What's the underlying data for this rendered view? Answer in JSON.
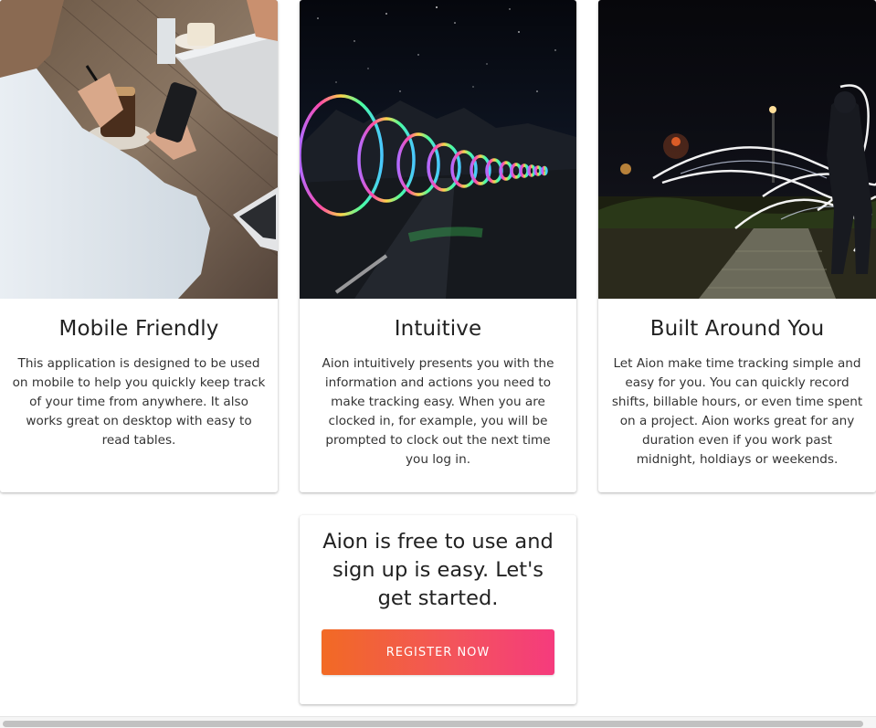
{
  "features": [
    {
      "image": "person-using-phone-at-cafe-photo",
      "title": "Mobile Friendly",
      "text": "This application is designed to be used on mobile to help you quickly keep track of your time from anywhere. It also works great on desktop with easy to read tables."
    },
    {
      "image": "light-painting-spiral-night-road-photo",
      "title": "Intuitive",
      "text": "Aion intuitively presents you with the information and actions you need to make tracking easy. When you are clocked in, for example, you will be prompted to clock out the next time you log in."
    },
    {
      "image": "person-light-painting-at-night-photo",
      "title": "Built Around You",
      "text": "Let Aion make time tracking simple and easy for you. You can quickly record shifts, billable hours, or even time spent on a project. Aion works great for any duration even if you work past midnight, holdiays or weekends."
    }
  ],
  "cta": {
    "text": "Aion is free to use and sign up is easy. Let's get started.",
    "button_label": "REGISTER NOW"
  },
  "colors": {
    "button_gradient_start": "#f26a24",
    "button_gradient_end": "#f53b7d",
    "card_background": "#ffffff",
    "page_background": "#ffffff"
  }
}
